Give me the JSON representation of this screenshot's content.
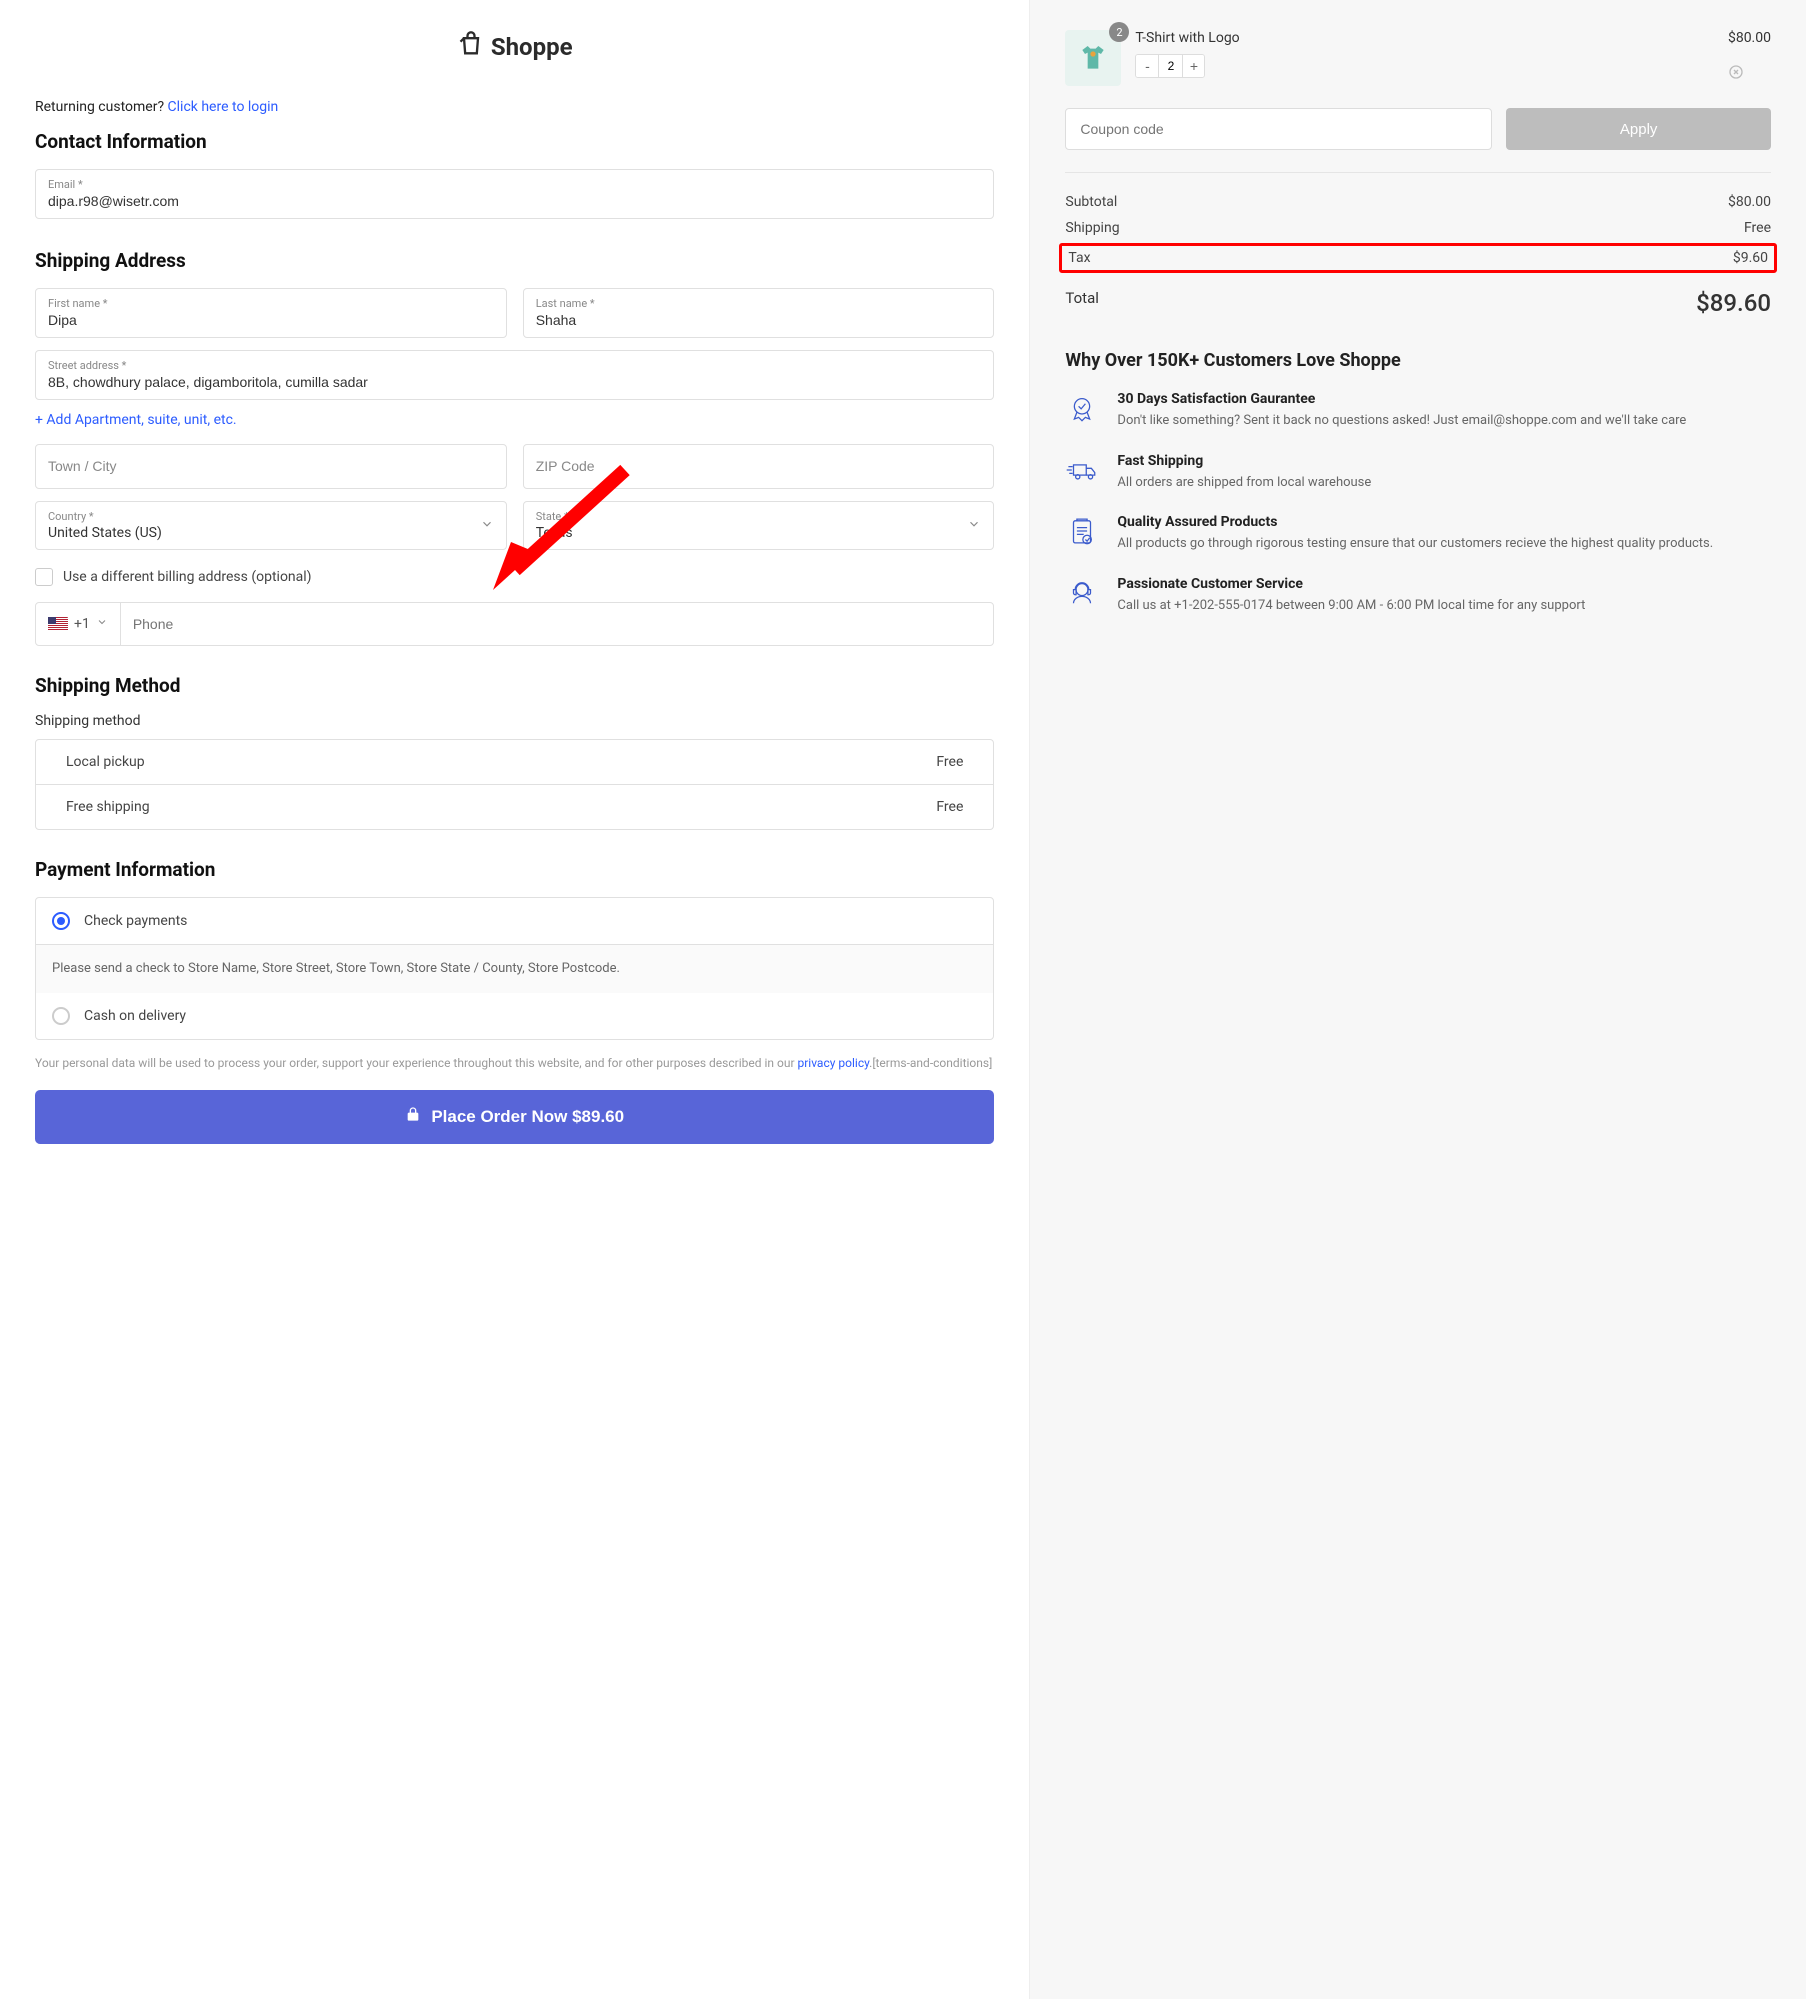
{
  "logo": "Shoppe",
  "returning": {
    "text": "Returning customer? ",
    "link": "Click here to login"
  },
  "contact": {
    "heading": "Contact Information",
    "email_label": "Email *",
    "email_value": "dipa.r98@wisetr.com"
  },
  "shipping": {
    "heading": "Shipping Address",
    "first_label": "First name *",
    "first_value": "Dipa",
    "last_label": "Last name *",
    "last_value": "Shaha",
    "street_label": "Street address *",
    "street_value": "8B, chowdhury palace, digamboritola, cumilla sadar",
    "add_apt": "+ Add Apartment, suite, unit, etc.",
    "town_ph": "Town / City",
    "zip_ph": "ZIP Code",
    "country_label": "Country *",
    "country_value": "United States (US)",
    "state_label": "State *",
    "state_value": "Texas",
    "diff_billing": "Use a different billing address (optional)",
    "dial_code": "+1",
    "phone_ph": "Phone"
  },
  "shipping_method": {
    "heading": "Shipping Method",
    "label": "Shipping method",
    "options": [
      {
        "name": "Local pickup",
        "price": "Free"
      },
      {
        "name": "Free shipping",
        "price": "Free"
      }
    ]
  },
  "payment": {
    "heading": "Payment Information",
    "options": [
      {
        "name": "Check payments",
        "checked": true,
        "info": "Please send a check to Store Name, Store Street, Store Town, Store State / County, Store Postcode."
      },
      {
        "name": "Cash on delivery",
        "checked": false
      }
    ]
  },
  "privacy": {
    "text1": "Your personal data will be used to process your order, support your experience throughout this website, and for other purposes described in our ",
    "link": "privacy policy",
    "text2": ".[terms-and-conditions]"
  },
  "place_order": "Place Order Now  $89.60",
  "cart": {
    "item": {
      "name": "T-Shirt with Logo",
      "qty": "2",
      "price": "$80.00",
      "badge": "2"
    },
    "coupon_ph": "Coupon code",
    "apply": "Apply",
    "subtotal_label": "Subtotal",
    "subtotal": "$80.00",
    "shipping_label": "Shipping",
    "shipping": "Free",
    "tax_label": "Tax",
    "tax": "$9.60",
    "total_label": "Total",
    "total": "$89.60"
  },
  "why": {
    "heading": "Why Over 150K+ Customers Love Shoppe",
    "items": [
      {
        "title": "30 Days Satisfaction Gaurantee",
        "body": "Don't like something? Sent it back no questions asked! Just email@shoppe.com and we'll take care"
      },
      {
        "title": "Fast Shipping",
        "body": "All orders are shipped from local warehouse"
      },
      {
        "title": "Quality Assured Products",
        "body": "All products go through rigorous testing ensure that our customers recieve the highest quality products."
      },
      {
        "title": "Passionate Customer Service",
        "body": "Call us at +1-202-555-0174 between 9:00 AM - 6:00 PM local time for any support"
      }
    ]
  }
}
